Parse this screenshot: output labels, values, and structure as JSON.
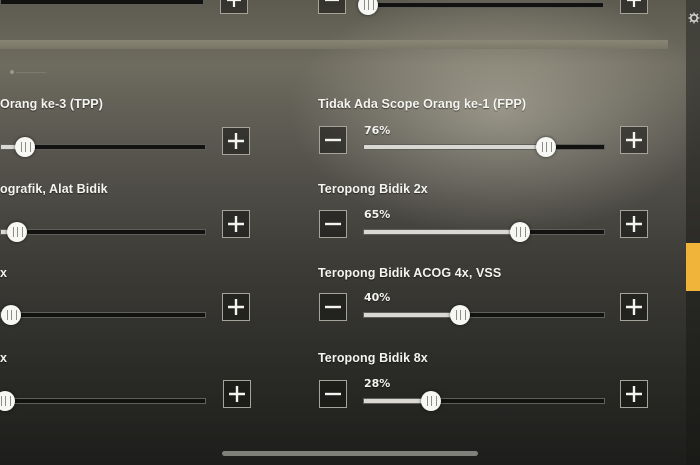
{
  "right_rail": {
    "icon": "gear-icon",
    "active_color": "#f0b43a"
  },
  "sliders_left": [
    {
      "label": "Orang ke-3 (TPP)",
      "value": 0.12
    },
    {
      "label": "ografik, Alat Bidik",
      "value": 0.08
    },
    {
      "label": "x",
      "value": 0.05
    },
    {
      "label": "x",
      "value": 0.02
    }
  ],
  "sliders_right": [
    {
      "label": "Tidak Ada Scope Orang ke-1 (FPP)",
      "percent_text": "76%",
      "value": 0.76
    },
    {
      "label": "Teropong Bidik 2x",
      "percent_text": "65%",
      "value": 0.65
    },
    {
      "label": "Teropong Bidik ACOG 4x, VSS",
      "percent_text": "40%",
      "value": 0.4
    },
    {
      "label": "Teropong Bidik 8x",
      "percent_text": "28%",
      "value": 0.28
    }
  ],
  "top_strip": {
    "left_value": 0.02,
    "right_value": 0.02
  }
}
